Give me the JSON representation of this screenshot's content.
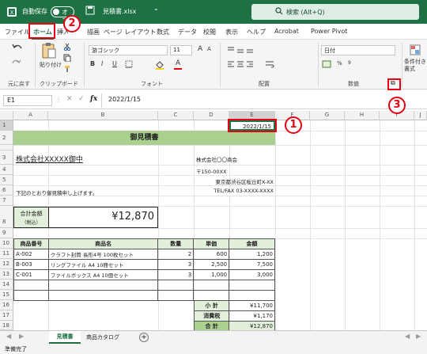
{
  "titlebar": {
    "autosave_label": "自動保存",
    "toggle_state": "オフ",
    "filename": "見積書.xlsx",
    "dropdown_glyph": "⌄",
    "search_placeholder": "検索 (Alt+Q)"
  },
  "menu": {
    "file": "ファイル",
    "home": "ホーム",
    "insert": "挿入",
    "draw": "描画",
    "page_layout": "ページ レイアウト",
    "formulas": "数式",
    "data": "データ",
    "review": "校閲",
    "view": "表示",
    "help": "ヘルプ",
    "acrobat": "Acrobat",
    "power_pivot": "Power Pivot"
  },
  "ribbon": {
    "undo_group": "元に戻す",
    "clipboard_group": "クリップボード",
    "paste_label": "貼り付け",
    "font_group": "フォント",
    "font_name": "游ゴシック",
    "font_size": "11",
    "bold": "B",
    "italic": "I",
    "underline": "U",
    "grow_font": "A",
    "shrink_font": "A",
    "font_color": "A",
    "alignment_group": "配置",
    "number_group": "数値",
    "number_format": "日付",
    "conditional_label": "条件付き書式",
    "dialog_launcher_glyph": "⧉"
  },
  "formula_bar": {
    "name_box": "E1",
    "fx": "fx",
    "value": "2022/1/15"
  },
  "columns": [
    "A",
    "B",
    "C",
    "D",
    "E",
    "F",
    "G",
    "H",
    "I",
    "J"
  ],
  "rows": [
    "1",
    "2",
    "3",
    "4",
    "5",
    "6",
    "7",
    "8",
    "9",
    "10",
    "11",
    "12",
    "13",
    "14",
    "15",
    "16",
    "17",
    "18"
  ],
  "sheet": {
    "date": "2022/1/15",
    "title": "御見積書",
    "customer": "株式会社XXXXX御中",
    "company": "株式会社〇〇商会",
    "zip": "〒150-00XX",
    "address": "東京都渋谷区桜丘町X-XX",
    "tel": "TEL/FAX 03-XXXX-XXXX",
    "note": "下記のとおり御見積申し上げます。",
    "total_label": "合計金額",
    "total_label_sub": "（税込）",
    "total_amount": "¥12,870",
    "table_headers": [
      "商品番号",
      "商品名",
      "数量",
      "単価",
      "金額"
    ],
    "items": [
      {
        "code": "A-002",
        "name": "クラフト封筒 長形4号 100枚セット",
        "qty": "2",
        "price": "600",
        "amount": "1,200"
      },
      {
        "code": "B-003",
        "name": "リングファイル A4 10冊セット",
        "qty": "3",
        "price": "2,500",
        "amount": "7,500"
      },
      {
        "code": "C-001",
        "name": "ファイルボックス A4 10個セット",
        "qty": "3",
        "price": "1,000",
        "amount": "3,000"
      }
    ],
    "subtotal_label": "小 計",
    "subtotal": "¥11,700",
    "tax_label": "消費税",
    "tax": "¥1,170",
    "grand_label": "合 計",
    "grand": "¥12,870"
  },
  "tabs": {
    "active": "見積書",
    "other": "商品カタログ",
    "add": "+"
  },
  "status": {
    "ready": "準備完了"
  },
  "annotations": {
    "one": "1",
    "two": "2",
    "three": "3"
  },
  "colors": {
    "excel_green": "#1e7145",
    "header_green": "#a9d08e",
    "light_green": "#e2efda",
    "callout_red": "#e60012"
  }
}
